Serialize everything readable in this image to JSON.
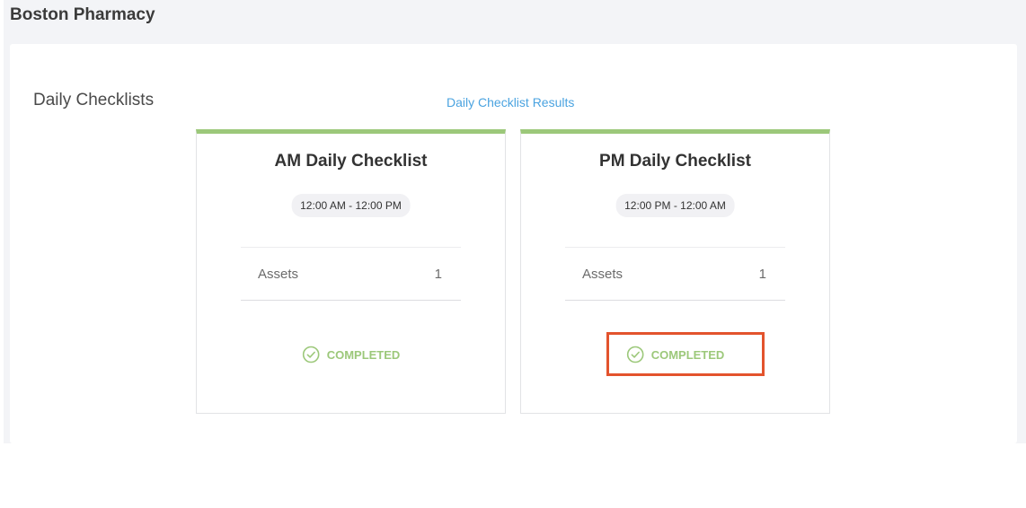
{
  "header": {
    "store_name": "Boston Pharmacy"
  },
  "section": {
    "title": "Daily Checklists",
    "results_link": "Daily Checklist Results"
  },
  "cards": [
    {
      "title": "AM Daily Checklist",
      "time_range": "12:00 AM - 12:00 PM",
      "assets_label": "Assets",
      "assets_count": "1",
      "status": "COMPLETED",
      "status_icon": "check-circle-icon"
    },
    {
      "title": "PM Daily Checklist",
      "time_range": "12:00 PM - 12:00 AM",
      "assets_label": "Assets",
      "assets_count": "1",
      "status": "COMPLETED",
      "status_icon": "check-circle-icon"
    }
  ],
  "colors": {
    "accent_green": "#9cc87a",
    "link_blue": "#4aa3e0",
    "highlight_red": "#e3532d",
    "background": "#f3f4f7"
  }
}
